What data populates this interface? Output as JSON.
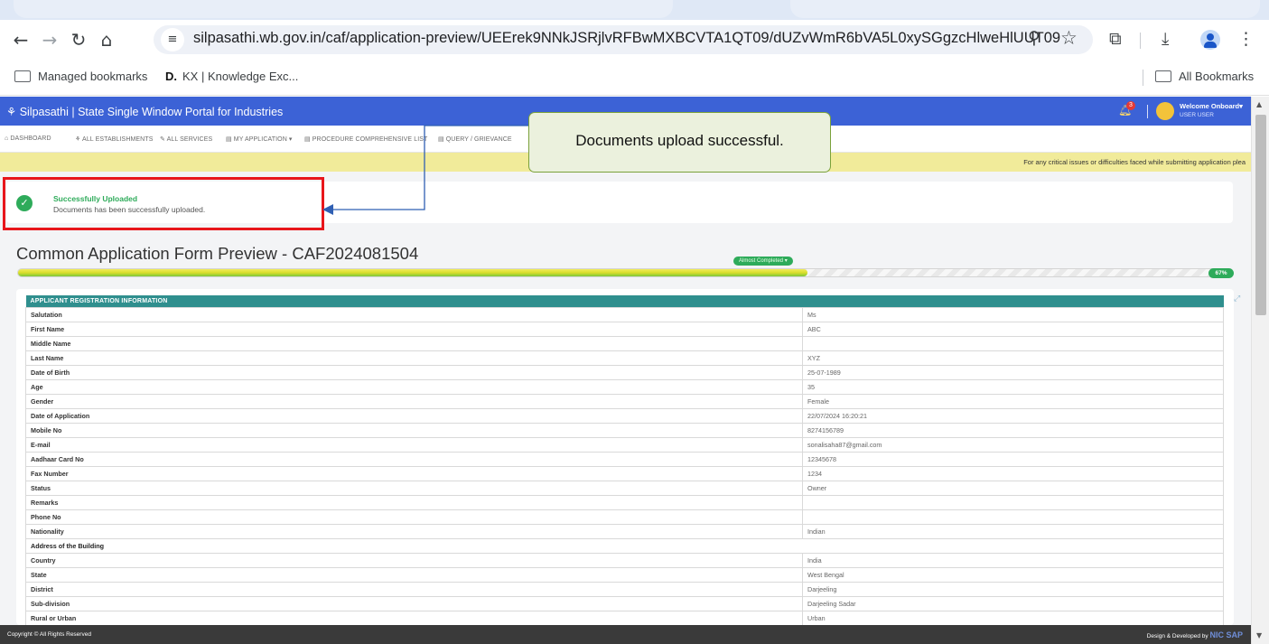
{
  "browser": {
    "url": "silpasathi.wb.gov.in/caf/application-preview/UEErek9NNkJSRjlvRFBwMXBCVTA1QT09/dUZvWmR6bVA5L0xySGgzcHlweHlUUT09",
    "bookmarks": {
      "managed": "Managed bookmarks",
      "kx_letter": "D.",
      "kx": "KX | Knowledge Exc...",
      "all": "All Bookmarks"
    }
  },
  "portal": {
    "title": "Silpasathi | State Single Window Portal for Industries",
    "notification_count": "3",
    "welcome": "Welcome Onboard",
    "user": "USER USER",
    "menu": [
      "DASHBOARD",
      "ALL ESTABLISHMENTS",
      "ALL SERVICES",
      "MY APPLICATION",
      "PROCEDURE COMPREHENSIVE LIST",
      "QUERY / GRIEVANCE"
    ],
    "marquee": "For any critical issues or difficulties faced while submitting application plea"
  },
  "alert": {
    "title": "Successfully Uploaded",
    "message": "Documents has been successfully uploaded."
  },
  "callout": "Documents upload successful.",
  "form": {
    "title": "Common Application Form Preview -  CAF2024081504",
    "progress_label": "Almost Completed",
    "progress_percent": "67%",
    "progress_fraction": 0.65
  },
  "table": {
    "heading": "APPLICANT REGISTRATION INFORMATION",
    "rows": [
      {
        "label": "Salutation",
        "value": "Ms"
      },
      {
        "label": "First Name",
        "value": "ABC"
      },
      {
        "label": "Middle Name",
        "value": ""
      },
      {
        "label": "Last Name",
        "value": "XYZ"
      },
      {
        "label": "Date of Birth",
        "value": "25-07-1989"
      },
      {
        "label": "Age",
        "value": "35"
      },
      {
        "label": "Gender",
        "value": "Female"
      },
      {
        "label": "Date of Application",
        "value": "22/07/2024 16:20:21"
      },
      {
        "label": "Mobile No",
        "value": "8274156789"
      },
      {
        "label": "E-mail",
        "value": "sonalisaha87@gmail.com"
      },
      {
        "label": "Aadhaar Card No",
        "value": "12345678"
      },
      {
        "label": "Fax Number",
        "value": "1234"
      },
      {
        "label": "Status",
        "value": "Owner"
      },
      {
        "label": "Remarks",
        "value": ""
      },
      {
        "label": "Phone No",
        "value": ""
      },
      {
        "label": "Nationality",
        "value": "Indian"
      },
      {
        "label": "Address of the Building",
        "value": "",
        "section": true
      },
      {
        "label": "Country",
        "value": "India"
      },
      {
        "label": "State",
        "value": "West Bengal"
      },
      {
        "label": "District",
        "value": "Darjeeling"
      },
      {
        "label": "Sub-division",
        "value": "Darjeeling Sadar"
      },
      {
        "label": "Rural or Urban",
        "value": "Urban"
      }
    ]
  },
  "footer": {
    "copyright": "Copyright © All Rights Reserved",
    "credit": "Design & Developed by",
    "nic": "NIC SAP"
  },
  "icons": {
    "back": "arrow-left-icon",
    "forward": "arrow-right-icon",
    "reload": "reload-icon",
    "home": "home-icon",
    "success": "check-circle-icon"
  },
  "colors": {
    "header": "#3c62d6",
    "success": "#2eab5a",
    "table_header": "#2f8f8e",
    "highlight": "#e8161b",
    "callout_bg": "#ebf1dd"
  }
}
